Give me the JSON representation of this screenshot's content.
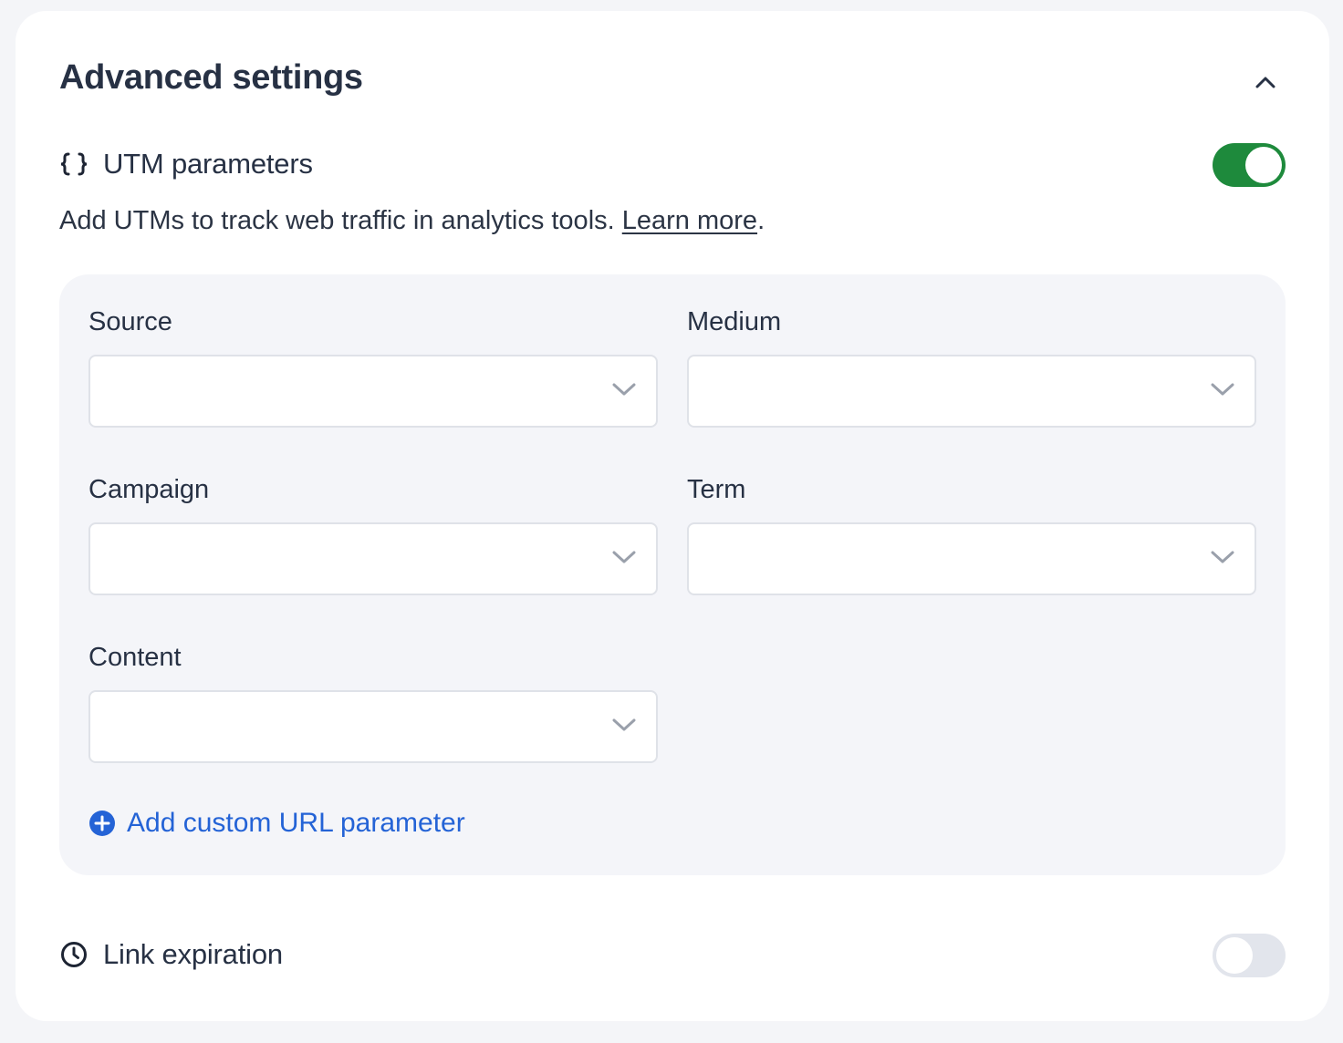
{
  "section": {
    "title": "Advanced settings",
    "collapse_icon": "chevron-up-icon"
  },
  "utm": {
    "icon": "curly-braces-icon",
    "label": "UTM parameters",
    "enabled": true,
    "description": "Add UTMs to track web traffic in analytics tools. ",
    "learn_more": "Learn more",
    "period": ".",
    "fields": [
      {
        "label": "Source",
        "value": ""
      },
      {
        "label": "Medium",
        "value": ""
      },
      {
        "label": "Campaign",
        "value": ""
      },
      {
        "label": "Term",
        "value": ""
      },
      {
        "label": "Content",
        "value": ""
      }
    ],
    "add_custom": "Add custom URL parameter"
  },
  "expiration": {
    "icon": "clock-icon",
    "label": "Link expiration",
    "enabled": false
  },
  "colors": {
    "toggle_on": "#1e8a3c",
    "toggle_off": "#e2e5ec",
    "link_blue": "#2463d6"
  }
}
